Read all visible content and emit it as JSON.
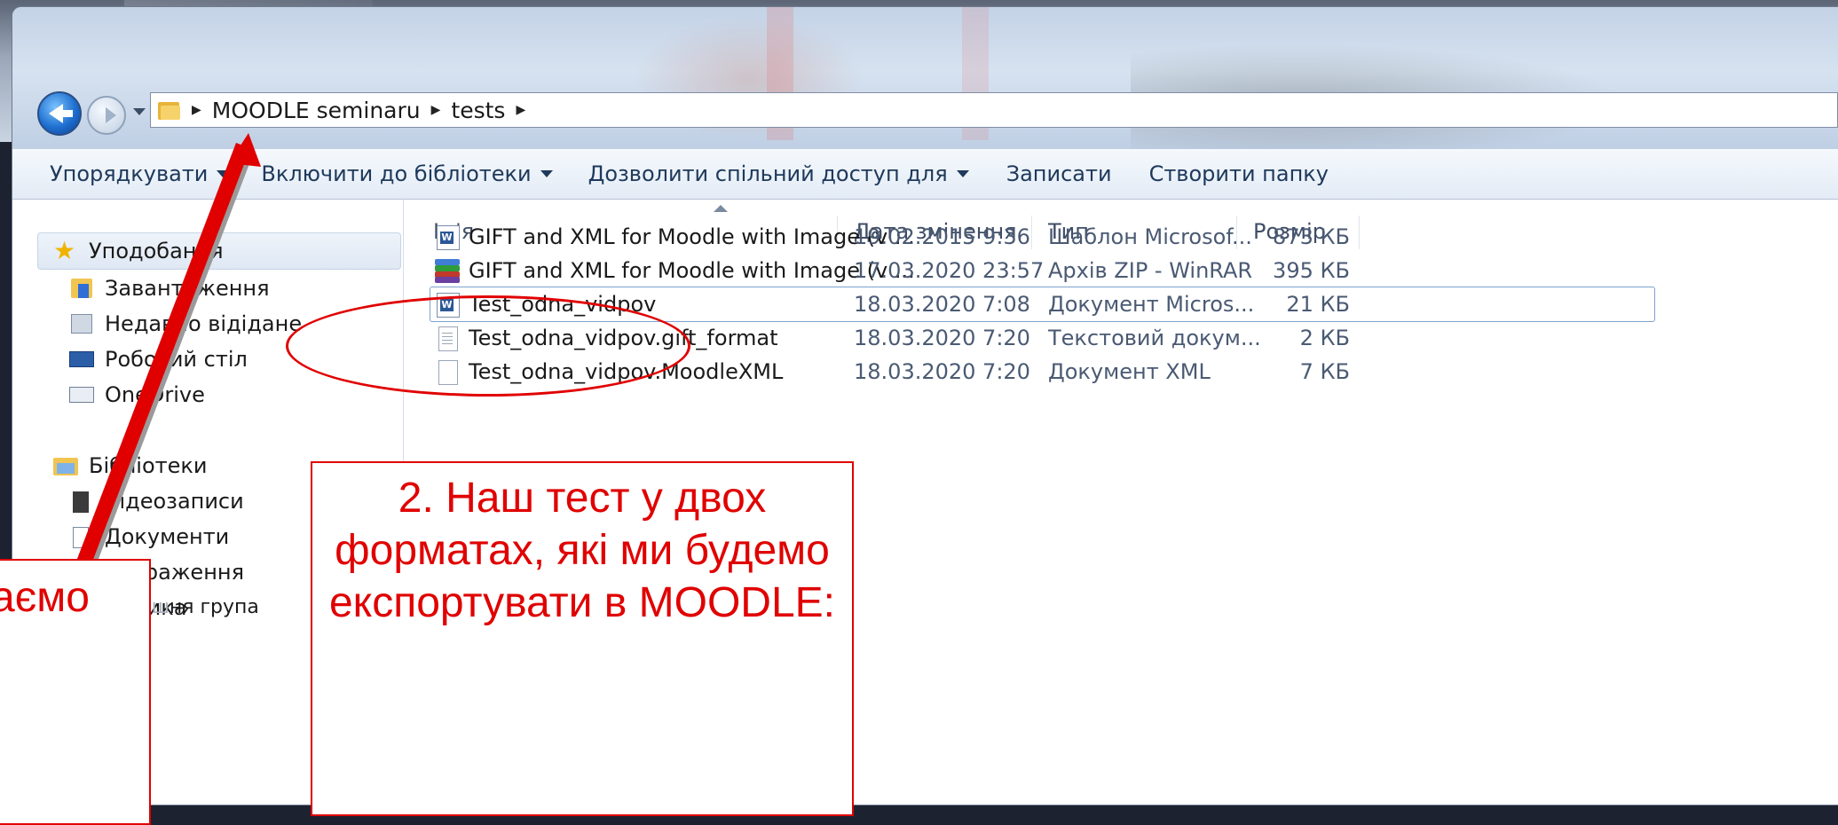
{
  "address": {
    "segments": [
      "MOODLE seminaru",
      "tests"
    ]
  },
  "toolbar": {
    "organize": "Упорядкувати",
    "include_library": "Включити до бібліотеки",
    "share": "Дозволити спільний доступ для",
    "burn": "Записати",
    "new_folder": "Створити папку"
  },
  "sidebar": {
    "favorites": "Уподобання",
    "fav_items": [
      "Завантаження",
      "Недавно відідане",
      "Робочий стіл",
      "OneDrive"
    ],
    "libraries": "Бібліотеки",
    "lib_items": [
      "Відеозаписи",
      "Документи",
      "Зображення",
      "Музика"
    ],
    "homegroup_prefix": "Домаш",
    "homegroup_suffix": "ня група"
  },
  "columns": {
    "name": "Ім'я",
    "date": "Дата змінення",
    "type": "Тип",
    "size": "Розмір"
  },
  "files": [
    {
      "name": "GIFT and XML for Moodle with Image (v ...",
      "date": "19.02.2015 9:36",
      "type": "Шаблон Microsof...",
      "size": "873 КБ",
      "icon": "word-template-icon"
    },
    {
      "name": "GIFT and XML for Moodle with Image (v ...",
      "date": "17.03.2020 23:57",
      "type": "Архів ZIP - WinRAR",
      "size": "395 КБ",
      "icon": "winrar-archive-icon"
    },
    {
      "name": "Test_odna_vidpov",
      "date": "18.03.2020 7:08",
      "type": "Документ Micros...",
      "size": "21 КБ",
      "icon": "word-document-icon"
    },
    {
      "name": "Test_odna_vidpov.gift_format",
      "date": "18.03.2020 7:20",
      "type": "Текстовий докум...",
      "size": "2 КБ",
      "icon": "text-file-icon"
    },
    {
      "name": "Test_odna_vidpov.MoodleXML",
      "date": "18.03.2020 7:20",
      "type": "Документ XML",
      "size": "7 КБ",
      "icon": "xml-file-icon"
    }
  ],
  "annotations": {
    "callout_2": "2. Наш тест у двох форматах, які ми будемо експортувати в MOODLE:",
    "callout_left": "аємо",
    "color": "#e00000"
  }
}
